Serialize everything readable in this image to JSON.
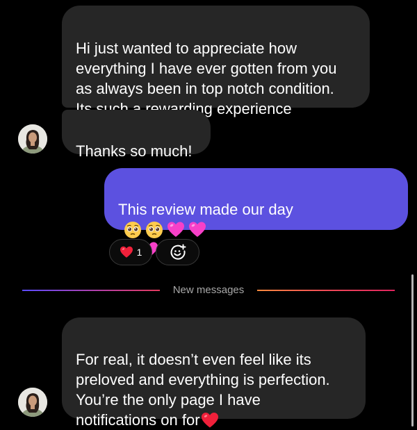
{
  "messages": [
    {
      "direction": "incoming",
      "text": "Hi just wanted to appreciate how\neverything I have ever gotten from you\nas always been in top notch condition.\nIts such a rewarding experience"
    },
    {
      "direction": "incoming",
      "text": "Thanks so much!"
    },
    {
      "direction": "outgoing",
      "text": "This review made our day",
      "emojis": [
        "pleading-face",
        "pleading-face",
        "pink-heart",
        "pink-heart",
        "pink-heart",
        "pink-heart"
      ]
    },
    {
      "direction": "incoming",
      "text": "For real, it doesn’t even feel like its\npreloved and everything is perfection.\nYou’re the only page I have\nnotifications on for",
      "trailing_emoji": "red-heart"
    }
  ],
  "reactions": {
    "heart_emoji": "red-heart",
    "heart_count": "1",
    "add_reaction_icon": "add-reaction-icon"
  },
  "divider": {
    "label": "New messages"
  },
  "colors": {
    "background": "#000000",
    "incoming_bubble": "#262626",
    "outgoing_bubble": "#5c51e0",
    "divider_text": "#a8a8a8"
  }
}
